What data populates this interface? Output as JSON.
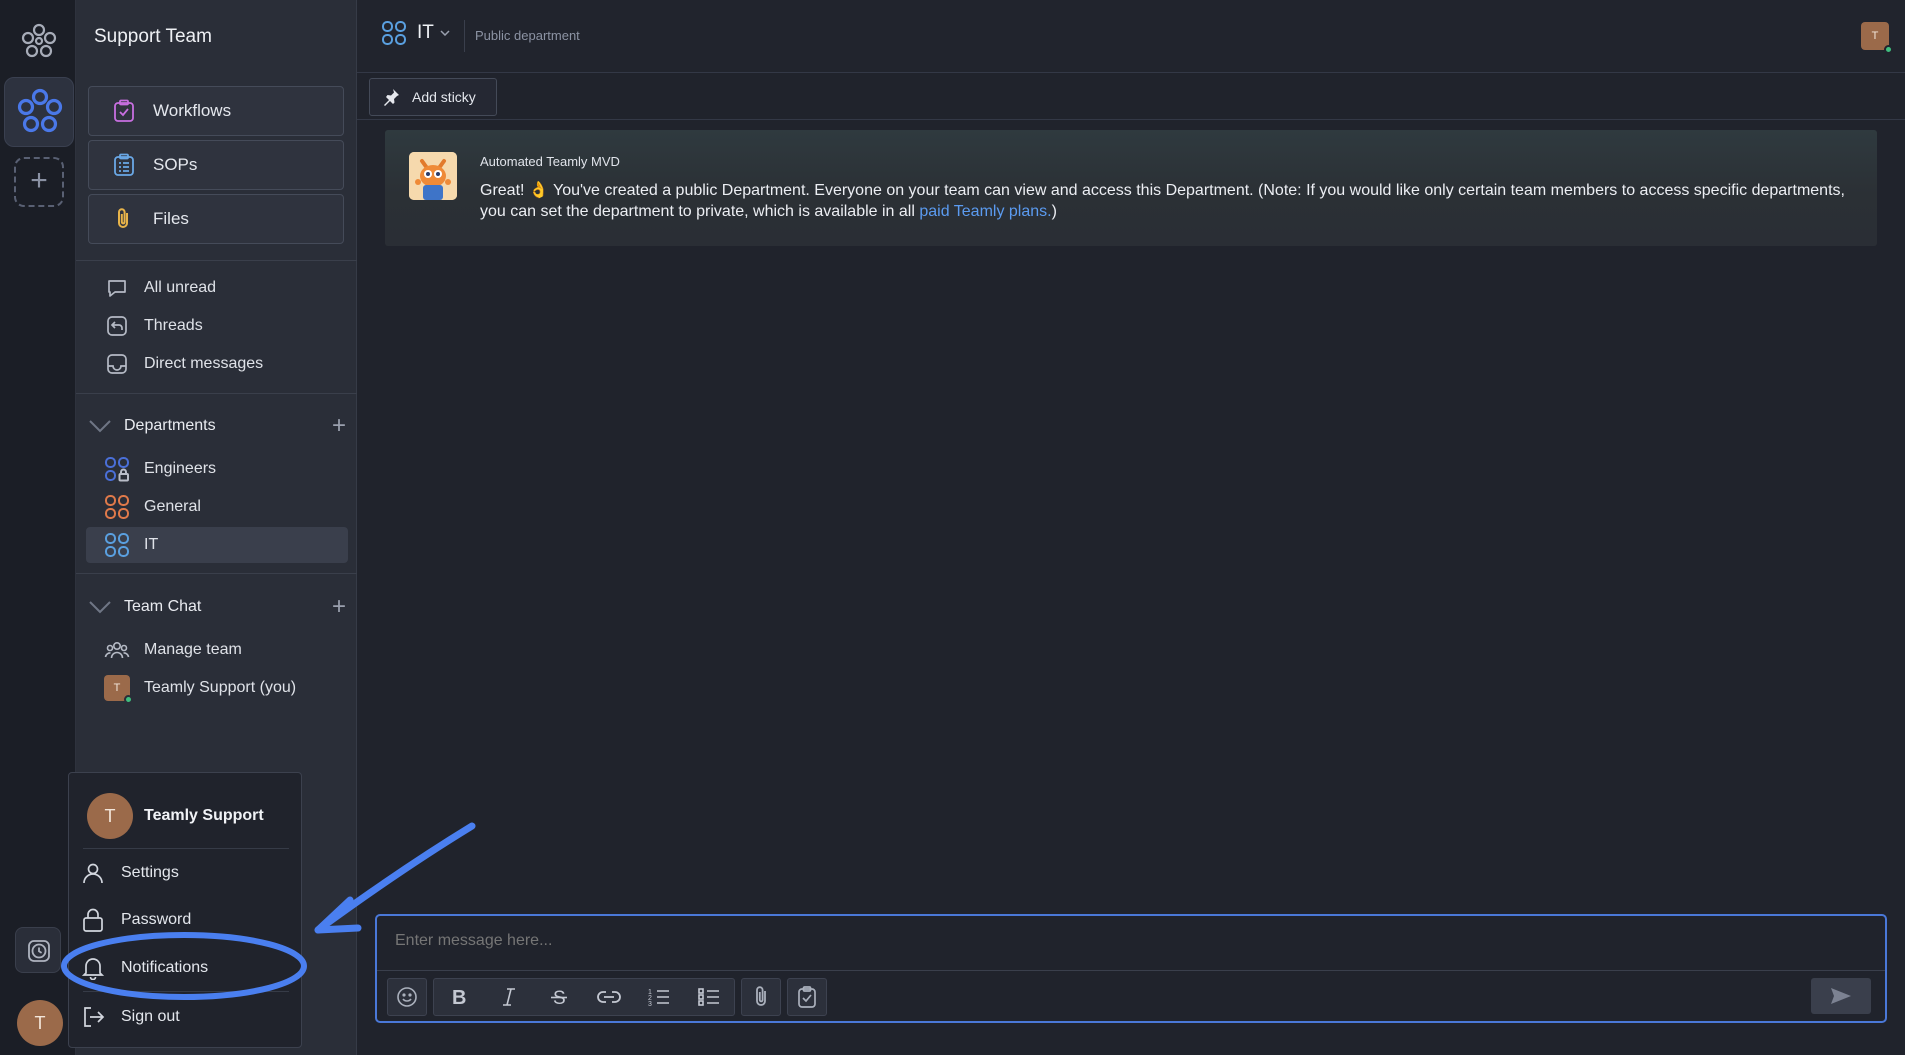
{
  "sidebar": {
    "team_name": "Support Team",
    "cards": [
      {
        "label": "Workflows",
        "icon": "workflow-icon"
      },
      {
        "label": "SOPs",
        "icon": "sop-icon"
      },
      {
        "label": "Files",
        "icon": "paperclip-icon"
      }
    ],
    "nav": [
      {
        "label": "All unread",
        "icon": "chat-bubble-icon"
      },
      {
        "label": "Threads",
        "icon": "threads-icon"
      },
      {
        "label": "Direct messages",
        "icon": "inbox-icon"
      }
    ],
    "departments": {
      "title": "Departments",
      "items": [
        {
          "label": "Engineers",
          "color": "#4a6fd8"
        },
        {
          "label": "General",
          "color": "#e07a4a"
        },
        {
          "label": "IT",
          "color": "#5aa0e0"
        }
      ]
    },
    "team_chat": {
      "title": "Team Chat",
      "items": [
        {
          "label": "Manage team"
        },
        {
          "label": "Teamly Support (you)",
          "avatar_letter": "T"
        }
      ]
    }
  },
  "header": {
    "title": "IT",
    "subtitle": "Public department",
    "avatar_letter": "T"
  },
  "toolbar": {
    "add_sticky": "Add sticky"
  },
  "message": {
    "author": "Automated Teamly MVD",
    "text_before": "Great! 👌 You've created a public Department. Everyone on your team can view and access this Department. (Note: If you would like only certain team members to access specific departments, you can set the department to private, which is available in all ",
    "link_text": "paid Teamly plans.",
    "text_after": ")"
  },
  "composer": {
    "placeholder": "Enter message here..."
  },
  "rail": {
    "avatar_letter": "T"
  },
  "user_menu": {
    "avatar_letter": "T",
    "name": "Teamly Support",
    "items": [
      {
        "label": "Settings",
        "icon": "user-icon"
      },
      {
        "label": "Password",
        "icon": "lock-icon"
      },
      {
        "label": "Notifications",
        "icon": "bell-icon"
      },
      {
        "label": "Sign out",
        "icon": "sign-out-icon"
      }
    ]
  },
  "colors": {
    "accent": "#4a78d8",
    "link": "#5b9bf0",
    "annotation": "#4a7ff0"
  }
}
